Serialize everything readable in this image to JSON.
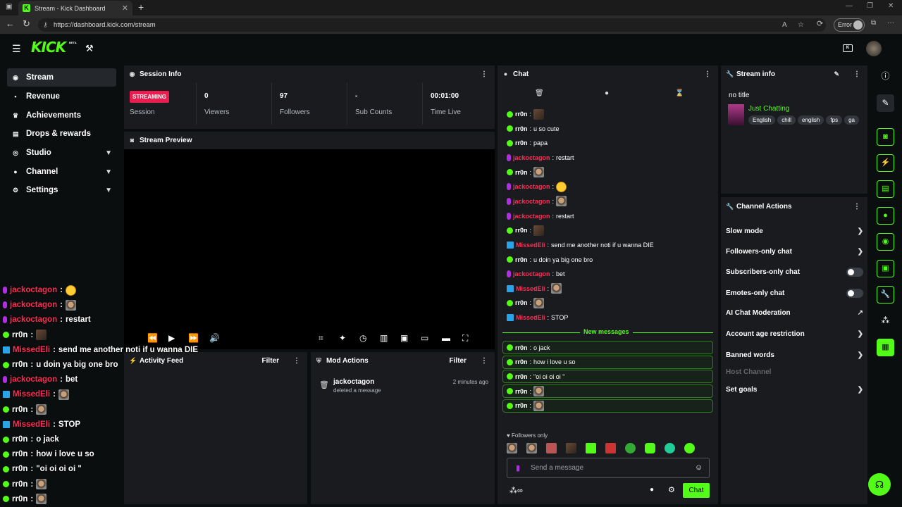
{
  "browser": {
    "tab_title": "Stream - Kick Dashboard",
    "url": "https://dashboard.kick.com/stream",
    "error_label": "Error"
  },
  "header": {
    "logo": "KICK",
    "beta": "BETA"
  },
  "sidebar": {
    "items": [
      {
        "label": "Stream",
        "icon": "broadcast-icon"
      },
      {
        "label": "Revenue",
        "icon": "revenue-icon"
      },
      {
        "label": "Achievements",
        "icon": "trophy-icon"
      },
      {
        "label": "Drops & rewards",
        "icon": "gift-icon"
      },
      {
        "label": "Studio",
        "icon": "studio-icon"
      },
      {
        "label": "Channel",
        "icon": "user-icon"
      },
      {
        "label": "Settings",
        "icon": "gear-icon"
      }
    ]
  },
  "overlay_chat": [
    {
      "user": "jackoctagon",
      "badge": "purple",
      "color": "#ff2d55",
      "text": "",
      "emote": "yellow"
    },
    {
      "user": "jackoctagon",
      "badge": "purple",
      "color": "#ff2d55",
      "text": "",
      "emote": "face"
    },
    {
      "user": "jackoctagon",
      "badge": "purple",
      "color": "#ff2d55",
      "text": "restart",
      "emote": ""
    },
    {
      "user": "rr0n",
      "badge": "green",
      "color": "#ffffff",
      "text": "",
      "emote": "dark"
    },
    {
      "user": "MissedEli",
      "badge": "blue",
      "color": "#ff2d55",
      "text": "send me another noti if u wanna DIE",
      "emote": ""
    },
    {
      "user": "rr0n",
      "badge": "green",
      "color": "#ffffff",
      "text": "u doin ya big one bro",
      "emote": ""
    },
    {
      "user": "jackoctagon",
      "badge": "purple",
      "color": "#ff2d55",
      "text": "bet",
      "emote": ""
    },
    {
      "user": "MissedEli",
      "badge": "blue",
      "color": "#ff2d55",
      "text": "",
      "emote": "face"
    },
    {
      "user": "rr0n",
      "badge": "green",
      "color": "#ffffff",
      "text": "",
      "emote": "face"
    },
    {
      "user": "MissedEli",
      "badge": "blue",
      "color": "#ff2d55",
      "text": "STOP",
      "emote": ""
    },
    {
      "user": "rr0n",
      "badge": "green",
      "color": "#ffffff",
      "text": "o jack",
      "emote": ""
    },
    {
      "user": "rr0n",
      "badge": "green",
      "color": "#ffffff",
      "text": "how i love u so",
      "emote": ""
    },
    {
      "user": "rr0n",
      "badge": "green",
      "color": "#ffffff",
      "text": "\"oi oi oi oi \"",
      "emote": ""
    },
    {
      "user": "rr0n",
      "badge": "green",
      "color": "#ffffff",
      "text": "",
      "emote": "face"
    },
    {
      "user": "rr0n",
      "badge": "green",
      "color": "#ffffff",
      "text": "",
      "emote": "face"
    }
  ],
  "session_info": {
    "title": "Session Info",
    "status_badge": "STREAMING",
    "status_label": "Session",
    "stats": [
      {
        "value": "0",
        "label": "Viewers"
      },
      {
        "value": "97",
        "label": "Followers"
      },
      {
        "value": "-",
        "label": "Sub Counts"
      },
      {
        "value": "00:01:00",
        "label": "Time Live"
      }
    ]
  },
  "stream_preview": {
    "title": "Stream Preview"
  },
  "activity_feed": {
    "title": "Activity Feed",
    "filter": "Filter"
  },
  "mod_actions": {
    "title": "Mod Actions",
    "filter": "Filter",
    "entries": [
      {
        "user": "jackoctagon",
        "action": "deleted a message",
        "time": "2 minutes ago"
      }
    ]
  },
  "chat": {
    "title": "Chat",
    "messages": [
      {
        "user": "rr0n",
        "badge": "green",
        "color": "#ffffff",
        "text": "",
        "emote": "dark"
      },
      {
        "user": "rr0n",
        "badge": "green",
        "color": "#ffffff",
        "text": "u so cute",
        "emote": ""
      },
      {
        "user": "rr0n",
        "badge": "green",
        "color": "#ffffff",
        "text": "papa",
        "emote": ""
      },
      {
        "user": "jackoctagon",
        "badge": "purple",
        "color": "#ff2d55",
        "text": "restart",
        "emote": ""
      },
      {
        "user": "rr0n",
        "badge": "green",
        "color": "#ffffff",
        "text": "",
        "emote": "face"
      },
      {
        "user": "jackoctagon",
        "badge": "purple",
        "color": "#ff2d55",
        "text": "",
        "emote": "yellow"
      },
      {
        "user": "jackoctagon",
        "badge": "purple",
        "color": "#ff2d55",
        "text": "",
        "emote": "face"
      },
      {
        "user": "jackoctagon",
        "badge": "purple",
        "color": "#ff2d55",
        "text": "restart",
        "emote": ""
      },
      {
        "user": "rr0n",
        "badge": "green",
        "color": "#ffffff",
        "text": "",
        "emote": "dark"
      },
      {
        "user": "MissedEli",
        "badge": "blue",
        "color": "#ff2d55",
        "text": "send me another noti if u wanna DIE",
        "emote": ""
      },
      {
        "user": "rr0n",
        "badge": "green",
        "color": "#ffffff",
        "text": "u doin ya big one bro",
        "emote": ""
      },
      {
        "user": "jackoctagon",
        "badge": "purple",
        "color": "#ff2d55",
        "text": "bet",
        "emote": ""
      },
      {
        "user": "MissedEli",
        "badge": "blue",
        "color": "#ff2d55",
        "text": "",
        "emote": "face"
      },
      {
        "user": "rr0n",
        "badge": "green",
        "color": "#ffffff",
        "text": "",
        "emote": "face"
      },
      {
        "user": "MissedEli",
        "badge": "blue",
        "color": "#ff2d55",
        "text": "STOP",
        "emote": ""
      }
    ],
    "new_messages_label": "New messages",
    "new_messages": [
      {
        "user": "rr0n",
        "text": "o jack",
        "emote": ""
      },
      {
        "user": "rr0n",
        "text": "how i love u so",
        "emote": ""
      },
      {
        "user": "rr0n",
        "text": "\"oi oi oi oi \"",
        "emote": ""
      },
      {
        "user": "rr0n",
        "text": "",
        "emote": "face"
      },
      {
        "user": "rr0n",
        "text": "",
        "emote": "face"
      }
    ],
    "followers_only": "Followers only",
    "input_placeholder": "Send a message",
    "send_label": "Chat"
  },
  "stream_info": {
    "title": "Stream info",
    "stream_title": "no title",
    "category": "Just Chatting",
    "tags": [
      "English",
      "chill",
      "english",
      "fps",
      "ga"
    ]
  },
  "channel_actions": {
    "title": "Channel Actions",
    "rows": [
      {
        "label": "Slow mode",
        "control": "chevron"
      },
      {
        "label": "Followers-only chat",
        "control": "chevron"
      },
      {
        "label": "Subscribers-only chat",
        "control": "toggle"
      },
      {
        "label": "Emotes-only chat",
        "control": "toggle"
      },
      {
        "label": "AI Chat Moderation",
        "control": "external"
      },
      {
        "label": "Account age restriction",
        "control": "chevron"
      },
      {
        "label": "Banned words",
        "control": "chevron"
      },
      {
        "label": "Host Channel",
        "control": "none"
      },
      {
        "label": "Set goals",
        "control": "chevron"
      }
    ]
  },
  "colors": {
    "accent": "#53fc18",
    "panel": "#191b1f",
    "background": "#0b0e0f",
    "streaming_badge": "#e91e4e",
    "username_red": "#ff2d55"
  }
}
